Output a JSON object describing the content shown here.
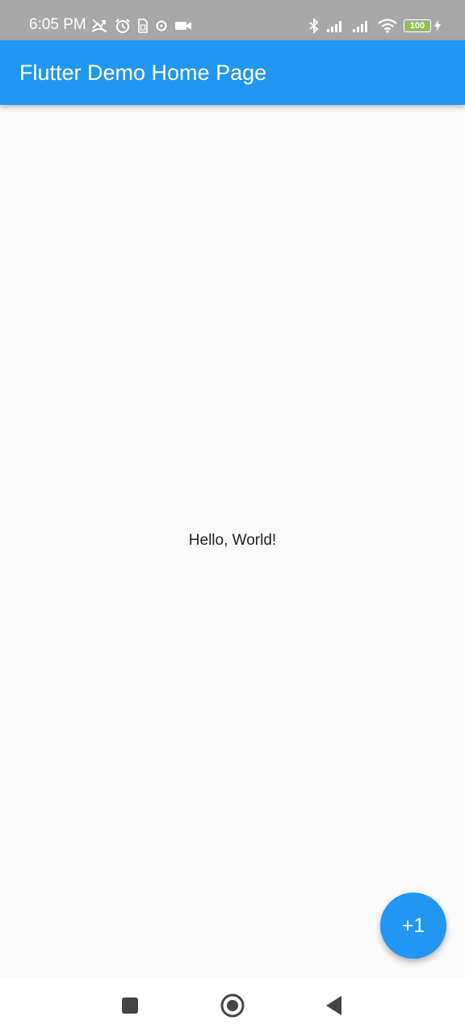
{
  "status_bar": {
    "time": "6:05 PM",
    "battery_level": "100",
    "left_icons": [
      "missed-call-icon",
      "alarm-icon",
      "sim-icon",
      "sync-icon",
      "video-camera-icon"
    ],
    "right_icons": [
      "bluetooth-icon",
      "signal-icon",
      "signal-icon",
      "wifi-icon",
      "battery-icon",
      "charging-bolt-icon"
    ],
    "background_color": "#a8a8a8",
    "battery_fill_color": "#8bc34a"
  },
  "app_bar": {
    "title": "Flutter Demo Home Page",
    "color": "#2196f3"
  },
  "main": {
    "text": "Hello, World!"
  },
  "fab": {
    "label": "+1",
    "color": "#2196f3"
  },
  "nav_bar": {
    "buttons": [
      "recents-square-icon",
      "home-circle-icon",
      "back-triangle-icon"
    ]
  }
}
